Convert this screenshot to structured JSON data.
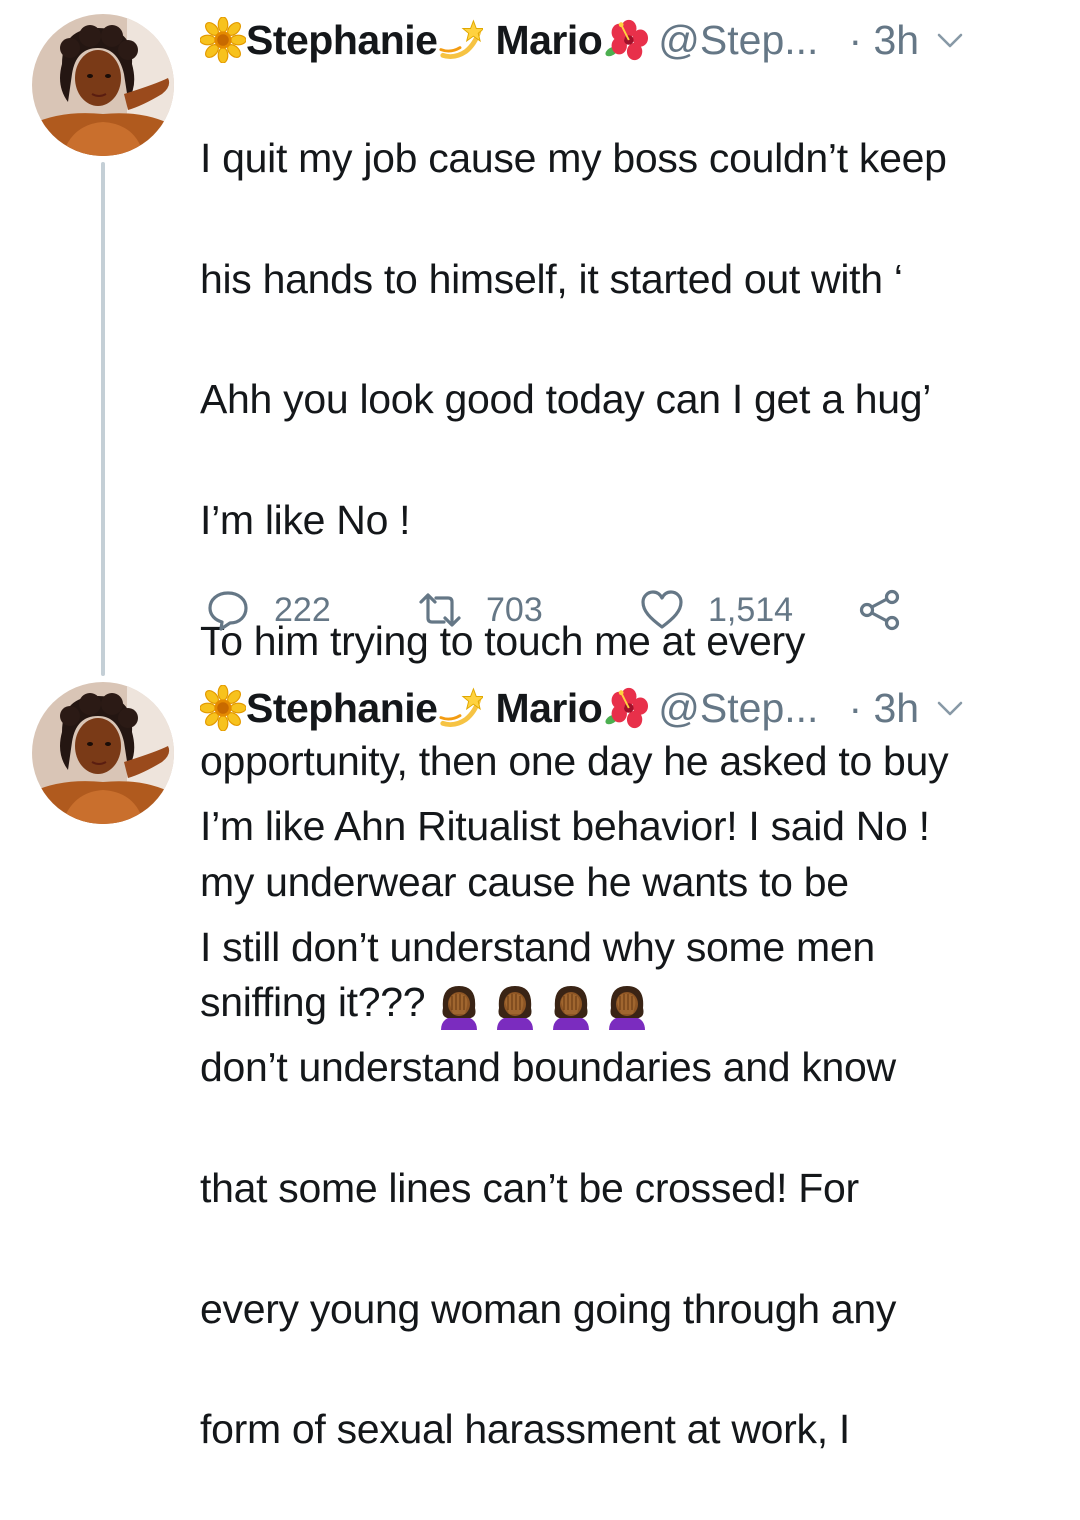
{
  "thread": [
    {
      "author": {
        "name_first": "Stephanie",
        "name_last": "Mario",
        "handle": "@Step...",
        "time": "· 3h",
        "icons": [
          "sunflower-emoji-icon",
          "dizzy-emoji-icon",
          "hibiscus-emoji-icon"
        ]
      },
      "lines": [
        "I quit my job cause my boss couldn’t keep",
        "his hands to himself, it started out with ‘",
        "Ahh you look good today can I get  a hug’",
        "I’m like No !",
        "To him trying to touch me at every",
        "opportunity, then one day he asked to buy",
        "my underwear cause he wants to be",
        "sniffing it???"
      ],
      "trailing_emoji": [
        "facepalm-emoji-icon",
        "facepalm-emoji-icon",
        "facepalm-emoji-icon",
        "facepalm-emoji-icon"
      ],
      "actions": {
        "replies": "222",
        "retweets": "703",
        "likes": "1,514"
      }
    },
    {
      "author": {
        "name_first": "Stephanie",
        "name_last": "Mario",
        "handle": "@Step...",
        "time": "· 3h",
        "icons": [
          "sunflower-emoji-icon",
          "dizzy-emoji-icon",
          "hibiscus-emoji-icon"
        ]
      },
      "lines": [
        "I’m like Ahn Ritualist behavior!  I said No !",
        "I still don’t understand why some men",
        "don’t understand boundaries and know",
        "that some lines can’t be crossed! For",
        "every young woman going through any",
        "form of sexual harassment at work, I"
      ]
    }
  ],
  "colors": {
    "text": "#14171a",
    "secondary": "#657786",
    "thread_line": "#c4cfd6",
    "background": "#ffffff"
  }
}
